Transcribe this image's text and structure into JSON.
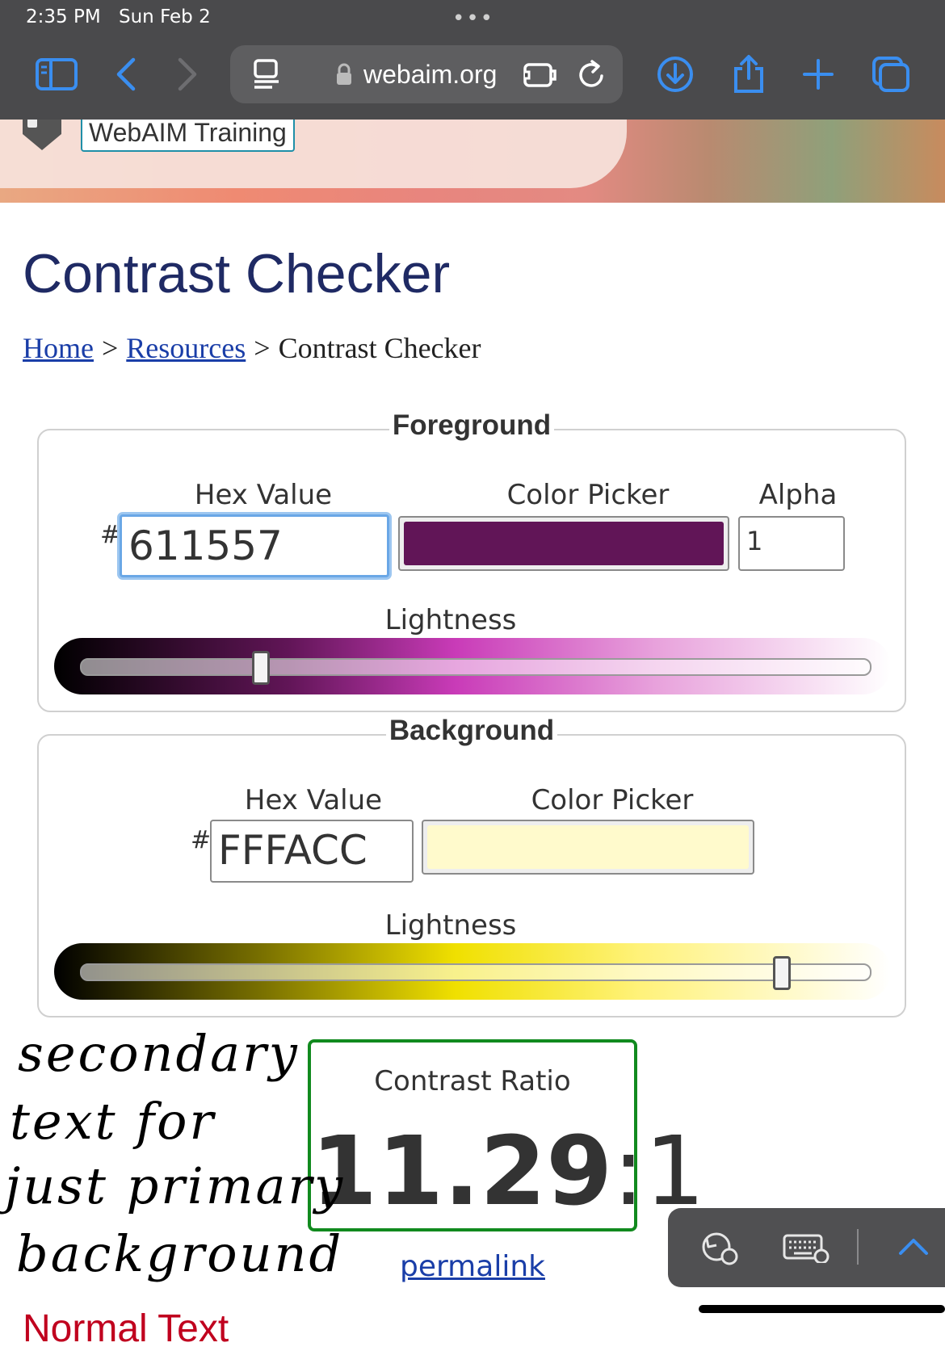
{
  "status_bar": {
    "time": "2:35 PM",
    "date": "Sun Feb 2",
    "dots": "•••"
  },
  "browser": {
    "url": "webaim.org"
  },
  "hero": {
    "training_button": "WebAIM Training"
  },
  "page": {
    "title": "Contrast Checker",
    "breadcrumb": [
      {
        "label": "Home"
      },
      {
        "label": "Resources"
      },
      {
        "label": "Contrast Checker"
      }
    ],
    "breadcrumb_separator": ">"
  },
  "foreground": {
    "legend": "Foreground",
    "hex_label": "Hex Value",
    "picker_label": "Color Picker",
    "alpha_label": "Alpha",
    "hash": "#",
    "hex_value": "611557",
    "color": "#611557",
    "alpha": "1",
    "lightness_label": "Lightness",
    "lightness_fraction": 0.23
  },
  "background": {
    "legend": "Background",
    "hex_label": "Hex Value",
    "picker_label": "Color Picker",
    "hash": "#",
    "hex_value": "FFFACC",
    "color": "#FFFACC",
    "lightness_label": "Lightness",
    "lightness_fraction": 0.89
  },
  "result": {
    "label": "Contrast Ratio",
    "ratio": "11.29",
    "suffix": ":1",
    "permalink": "permalink",
    "next_heading": "Normal Text",
    "border_color": "#118a1e"
  },
  "annotation": {
    "lines": [
      "secondary",
      "text for",
      "just primary",
      "background"
    ]
  },
  "icons": [
    "sidebar-icon",
    "back-icon",
    "forward-icon",
    "reader-icon",
    "lock-icon",
    "extension-icon",
    "reload-icon",
    "download-icon",
    "share-icon",
    "new-tab-icon",
    "tabs-icon",
    "undo-icon",
    "keyboard-icon",
    "chevron-up-icon"
  ]
}
